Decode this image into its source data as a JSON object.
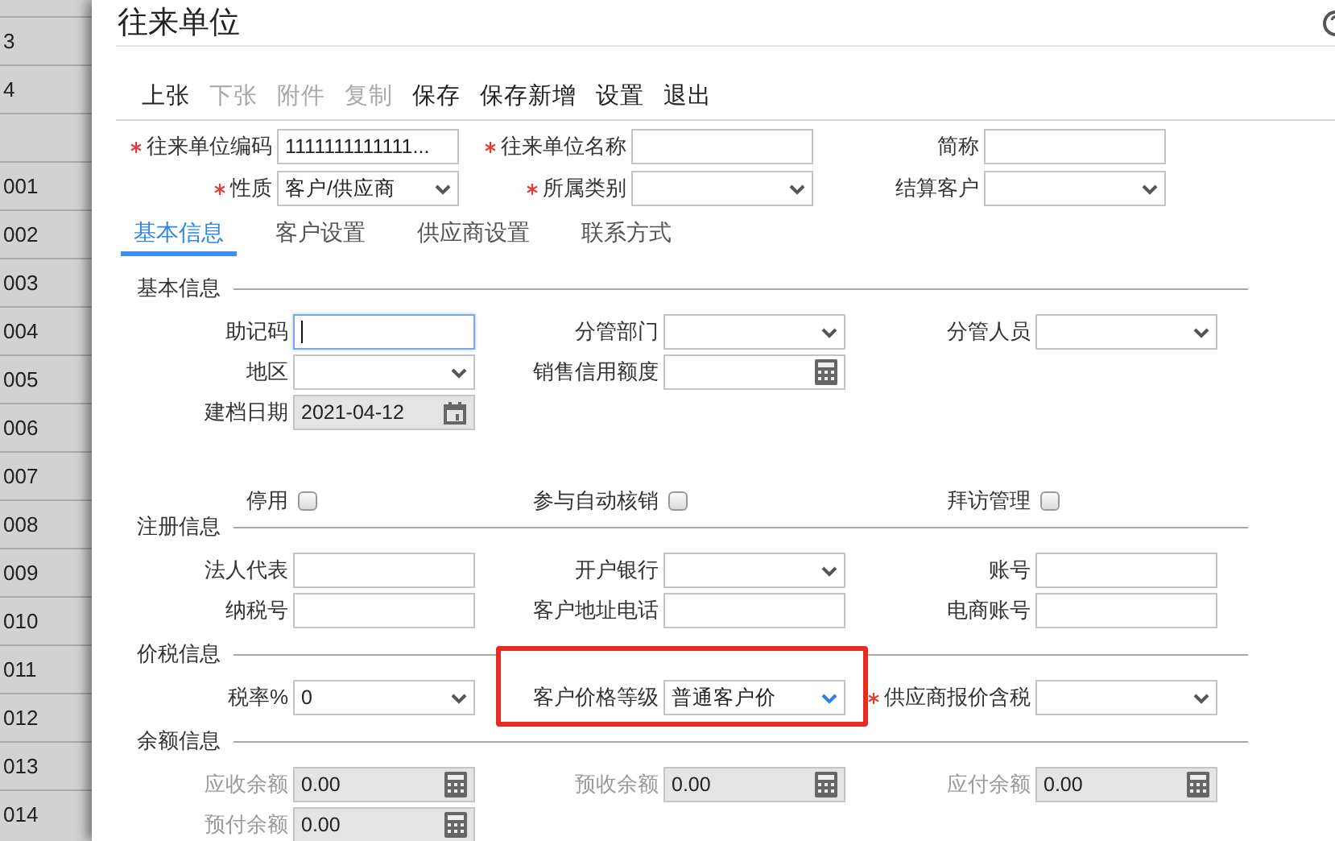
{
  "window": {
    "title": "往来单位"
  },
  "background_list": {
    "rows": [
      {
        "kind": "code",
        "code": "3"
      },
      {
        "kind": "code",
        "code": "4"
      },
      {
        "kind": "blank"
      },
      {
        "kind": "code",
        "code": "001"
      },
      {
        "kind": "code",
        "code": "002"
      },
      {
        "kind": "code",
        "code": "003"
      },
      {
        "kind": "code",
        "code": "004"
      },
      {
        "kind": "code",
        "code": "005"
      },
      {
        "kind": "code",
        "code": "006"
      },
      {
        "kind": "code",
        "code": "007"
      },
      {
        "kind": "code",
        "code": "008"
      },
      {
        "kind": "code",
        "code": "009"
      },
      {
        "kind": "code",
        "code": "010"
      },
      {
        "kind": "code",
        "code": "011"
      },
      {
        "kind": "code",
        "code": "012"
      },
      {
        "kind": "code",
        "code": "013"
      },
      {
        "kind": "code",
        "code": "014"
      }
    ]
  },
  "toolbar": [
    {
      "label": "上张",
      "disabled": false
    },
    {
      "label": "下张",
      "disabled": true
    },
    {
      "label": "附件",
      "disabled": true
    },
    {
      "label": "复制",
      "disabled": true
    },
    {
      "label": "保存",
      "disabled": false
    },
    {
      "label": "保存新增",
      "disabled": false
    },
    {
      "label": "设置",
      "disabled": false
    },
    {
      "label": "退出",
      "disabled": false
    }
  ],
  "header_rows": [
    {
      "fields": [
        {
          "label": "往来单位编码",
          "kind": "text",
          "required": true,
          "value": "1111111111111..."
        },
        {
          "label": "往来单位名称",
          "kind": "text",
          "required": true
        },
        {
          "label": "简称",
          "kind": "text",
          "required": false
        }
      ]
    },
    {
      "fields": [
        {
          "label": "性质",
          "kind": "select",
          "required": true,
          "value": "客户/供应商"
        },
        {
          "label": "所属类别",
          "kind": "select",
          "required": true
        },
        {
          "label": "结算客户",
          "kind": "select",
          "required": false
        }
      ]
    }
  ],
  "tabs": [
    {
      "label": "基本信息",
      "selected": true
    },
    {
      "label": "客户设置",
      "selected": false
    },
    {
      "label": "供应商设置",
      "selected": false
    },
    {
      "label": "联系方式",
      "selected": false
    }
  ],
  "sections": [
    {
      "title": "基本信息",
      "rows": [
        {
          "kind": "fields",
          "fields": [
            {
              "label": "助记码",
              "kind": "text",
              "focused": true
            },
            {
              "label": "分管部门",
              "kind": "select"
            },
            {
              "label": "分管人员",
              "kind": "select"
            }
          ]
        },
        {
          "kind": "fields",
          "fields": [
            {
              "label": "地区",
              "kind": "select"
            },
            {
              "label": "销售信用额度",
              "kind": "calc"
            }
          ]
        },
        {
          "kind": "fields",
          "fields": [
            {
              "label": "建档日期",
              "kind": "date",
              "value": "2021-04-12"
            }
          ]
        },
        {
          "kind": "checks",
          "fields": [
            {
              "label": "停用",
              "kind": "checkbox",
              "checked": false
            },
            {
              "label": "参与自动核销",
              "kind": "checkbox",
              "checked": false
            },
            {
              "label": "拜访管理",
              "kind": "checkbox",
              "checked": false
            }
          ]
        }
      ]
    },
    {
      "title": "注册信息",
      "rows": [
        {
          "kind": "fields",
          "fields": [
            {
              "label": "法人代表",
              "kind": "text"
            },
            {
              "label": "开户银行",
              "kind": "select"
            },
            {
              "label": "账号",
              "kind": "text"
            }
          ]
        },
        {
          "kind": "fields",
          "fields": [
            {
              "label": "纳税号",
              "kind": "text"
            },
            {
              "label": "客户地址电话",
              "kind": "text"
            },
            {
              "label": "电商账号",
              "kind": "text"
            }
          ]
        }
      ]
    },
    {
      "title": "价税信息",
      "rows": [
        {
          "kind": "fields",
          "fields": [
            {
              "label": "税率%",
              "kind": "select",
              "value": "0"
            },
            {
              "label": "客户价格等级",
              "kind": "select",
              "value": "普通客户价",
              "highlighted": true
            },
            {
              "label": "供应商报价含税",
              "kind": "select",
              "required": true
            }
          ]
        }
      ]
    },
    {
      "title": "余额信息",
      "rows": [
        {
          "kind": "fields",
          "fields": [
            {
              "label": "应收余额",
              "kind": "calc",
              "value": "0.00",
              "disabled": true
            },
            {
              "label": "预收余额",
              "kind": "calc",
              "value": "0.00",
              "disabled": true
            },
            {
              "label": "应付余额",
              "kind": "calc",
              "value": "0.00",
              "disabled": true
            }
          ]
        },
        {
          "kind": "fields",
          "fields": [
            {
              "label": "预付余额",
              "kind": "calc",
              "value": "0.00",
              "disabled": true
            }
          ]
        }
      ]
    }
  ]
}
